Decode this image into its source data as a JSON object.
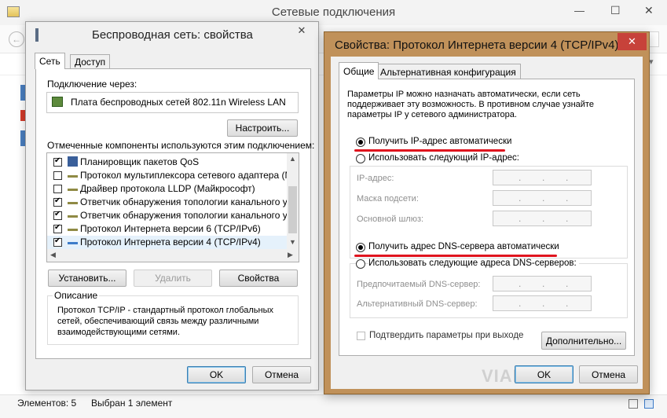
{
  "background_window": {
    "title": "Сетевые подключения",
    "controls": {
      "minimize": "—",
      "maximize": "☐",
      "close": "✕"
    }
  },
  "wireless_dialog": {
    "title": "Беспроводная сеть: свойства",
    "tabs": [
      {
        "label": "Сеть"
      },
      {
        "label": "Доступ"
      }
    ],
    "connect_using_label": "Подключение через:",
    "adapter_name": "Плата беспроводных сетей 802.11n Wireless LAN",
    "configure_button": "Настроить...",
    "components_label": "Отмеченные компоненты используются этим подключением:",
    "components": [
      {
        "label": "Планировщик пакетов QoS",
        "checked": true
      },
      {
        "label": "Протокол мультиплексора сетевого адаптера (Май",
        "checked": false
      },
      {
        "label": "Драйвер протокола LLDP (Майкрософт)",
        "checked": false
      },
      {
        "label": "Ответчик обнаружения топологии канального уров",
        "checked": true
      },
      {
        "label": "Ответчик обнаружения топологии канального уров",
        "checked": true
      },
      {
        "label": "Протокол Интернета версии 6 (TCP/IPv6)",
        "checked": true
      },
      {
        "label": "Протокол Интернета версии 4 (TCP/IPv4)",
        "checked": true
      }
    ],
    "install_button": "Установить...",
    "remove_button": "Удалить",
    "properties_button": "Свойства",
    "description_title": "Описание",
    "description_text": "Протокол TCP/IP - стандартный протокол глобальных сетей, обеспечивающий связь между различными взаимодействующими сетями.",
    "ok_button": "OK",
    "cancel_button": "Отмена"
  },
  "ipv4_dialog": {
    "title": "Свойства: Протокол Интернета версии 4 (TCP/IPv4)",
    "tabs": [
      {
        "label": "Общие"
      },
      {
        "label": "Альтернативная конфигурация"
      }
    ],
    "intro_text": "Параметры IP можно назначать автоматически, если сеть поддерживает эту возможность. В противном случае узнайте параметры IP у сетевого администратора.",
    "auto_ip_label": "Получить IP-адрес автоматически",
    "manual_ip_label": "Использовать следующий IP-адрес:",
    "ip_address_label": "IP-адрес:",
    "subnet_mask_label": "Маска подсети:",
    "gateway_label": "Основной шлюз:",
    "auto_dns_label": "Получить адрес DNS-сервера автоматически",
    "manual_dns_label": "Использовать следующие адреса DNS-серверов:",
    "preferred_dns_label": "Предпочитаемый DNS-сервер:",
    "alternate_dns_label": "Альтернативный DNS-сервер:",
    "validate_on_exit_label": "Подтвердить параметры при выходе",
    "advanced_button": "Дополнительно...",
    "ok_button": "OK",
    "cancel_button": "Отмена",
    "close_glyph": "✕"
  },
  "status_bar": {
    "items_count": "Элементов: 5",
    "selected_count": "Выбран 1 элемент"
  },
  "watermark": "VIARUM",
  "colors": {
    "accent_border": "#a97b3f",
    "highlight_line": "#e0141e",
    "dialog_bg": "#f0f0f0",
    "close_red": "#c7423a"
  }
}
